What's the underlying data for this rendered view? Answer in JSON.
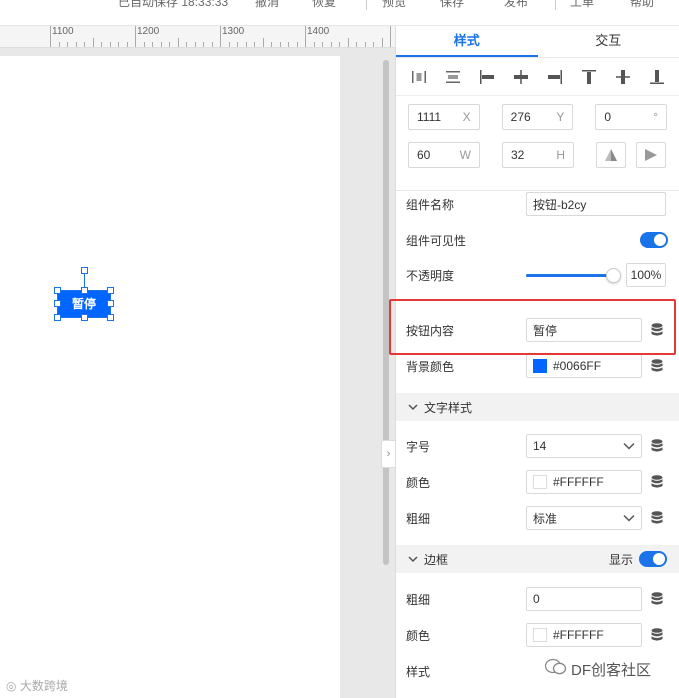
{
  "toolbar": {
    "autosave": "已自动保存 18:33:33",
    "undo": "撤消",
    "redo": "恢复",
    "preview": "预览",
    "save": "保存",
    "publish": "发布",
    "project": "工单",
    "help": "帮助"
  },
  "ruler": {
    "labels": [
      "1100",
      "1200",
      "1300",
      "1400"
    ]
  },
  "canvas": {
    "button_text": "暂停",
    "button_color": "#0066FF"
  },
  "panel": {
    "tabs": [
      "样式",
      "交互"
    ],
    "geometry": {
      "x": "1111",
      "x_unit": "X",
      "y": "276",
      "y_unit": "Y",
      "rotation": "0",
      "rotation_unit": "°",
      "w": "60",
      "w_unit": "W",
      "h": "32",
      "h_unit": "H"
    },
    "component_name_label": "组件名称",
    "component_name": "按钮-b2cy",
    "visible_label": "组件可见性",
    "opacity_label": "不透明度",
    "opacity_value": "100%",
    "opacity_fraction": 1.0,
    "content_label": "按钮内容",
    "content_value": "暂停",
    "bg_color_label": "背景颜色",
    "bg_color": "#0066FF",
    "text_style_section": "文字样式",
    "font_size_label": "字号",
    "font_size": "14",
    "text_color_label": "颜色",
    "text_color": "#FFFFFF",
    "font_weight_label": "粗细",
    "font_weight": "标准",
    "border_section": "边框",
    "border_show_label": "显示",
    "border_width_label": "粗细",
    "border_width": "0",
    "border_color_label": "颜色",
    "border_color": "#FFFFFF",
    "border_style_label": "样式"
  },
  "watermarks": {
    "left": "大数跨境",
    "right": "DF创客社区"
  },
  "colors": {
    "accent": "#1a73e8",
    "highlight": "#e53935"
  }
}
